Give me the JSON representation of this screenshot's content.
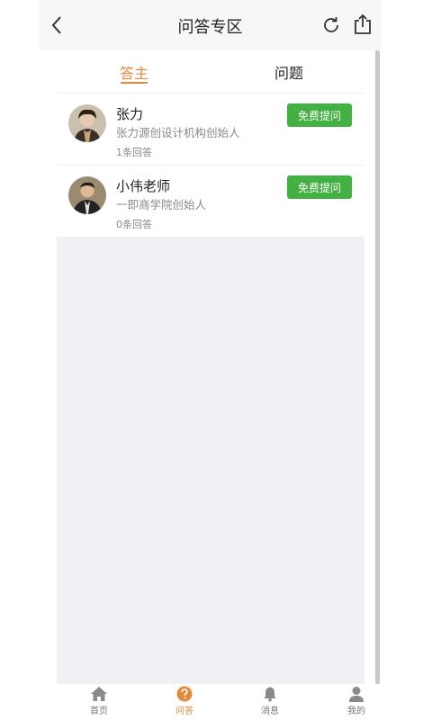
{
  "header": {
    "title": "问答专区"
  },
  "tabs": [
    {
      "label": "答主",
      "active": true
    },
    {
      "label": "问题",
      "active": false
    }
  ],
  "answerers": [
    {
      "name": "张力",
      "bio": "张力源创设计机构创始人",
      "answer_count": "1条回答",
      "button": "免费提问",
      "avatar_icon": "avatar-woman"
    },
    {
      "name": "小伟老师",
      "bio": "一即商学院创始人",
      "answer_count": "0条回答",
      "button": "免费提问",
      "avatar_icon": "avatar-man"
    }
  ],
  "bottom_nav": [
    {
      "label": "首页",
      "icon": "home-icon",
      "active": false
    },
    {
      "label": "问答",
      "icon": "question-icon",
      "active": true
    },
    {
      "label": "消息",
      "icon": "bell-icon",
      "active": false
    },
    {
      "label": "我的",
      "icon": "user-icon",
      "active": false
    }
  ],
  "colors": {
    "accent": "#e2893c",
    "button_green": "#43b043",
    "empty_bg": "#eff1f5"
  }
}
